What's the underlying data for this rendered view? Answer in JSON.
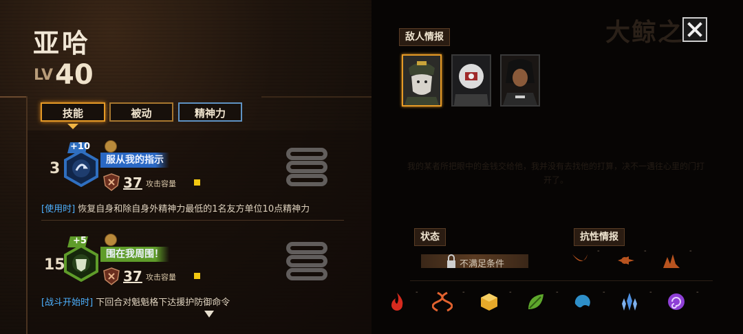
{
  "hero": {
    "name": "亚哈",
    "level_label": "LV",
    "level_value": "40"
  },
  "tabs": [
    {
      "label": "技能",
      "selected": true
    },
    {
      "label": "被动",
      "selected": false
    },
    {
      "label": "精神力",
      "selected": false
    }
  ],
  "skills": [
    {
      "cost": "3",
      "bonus": "+10",
      "name": "服从我的指示",
      "power": "37",
      "capacity_label": "攻击容量",
      "desc_tag": "[使用时]",
      "desc_text": " 恢复自身和除自身外精神力最低的1名友方单位10点精神力",
      "color": "#2f6fc0"
    },
    {
      "cost": "15",
      "bonus": "+5",
      "name": "围在我周围！",
      "power": "37",
      "capacity_label": "攻击容量",
      "desc_tag": "[战斗开始时]",
      "desc_text": " 下回合对魁魁格下达援护防御命令",
      "color": "#5f9c2a"
    }
  ],
  "right": {
    "enemy_info_label": "敌人情报",
    "ghost_title": "大鲸之",
    "ghost_text": "我的某者所把眼中的金钱交给他，我并没有去找他的打算，决不一遇往心里的门打开了。",
    "status_label": "状态",
    "status_text": "不满足条件",
    "resist_label": "抗性情报",
    "resist_dashes": [
      "-",
      "-",
      "-"
    ],
    "element_dashes": [
      "-",
      "-",
      "-",
      "-",
      "-",
      "-",
      "-"
    ]
  },
  "icons": {
    "close": "close-icon",
    "lock": "lock-icon",
    "elements": [
      "fire-icon",
      "dna-icon",
      "cube-icon",
      "leaf-icon",
      "wave-icon",
      "crystal-icon",
      "spiral-icon"
    ]
  },
  "colors": {
    "accent": "#e69a26",
    "spirit_tab": "#5f93c4",
    "desc_tag": "#4db1ff",
    "capacity_square": "#f2c811"
  }
}
